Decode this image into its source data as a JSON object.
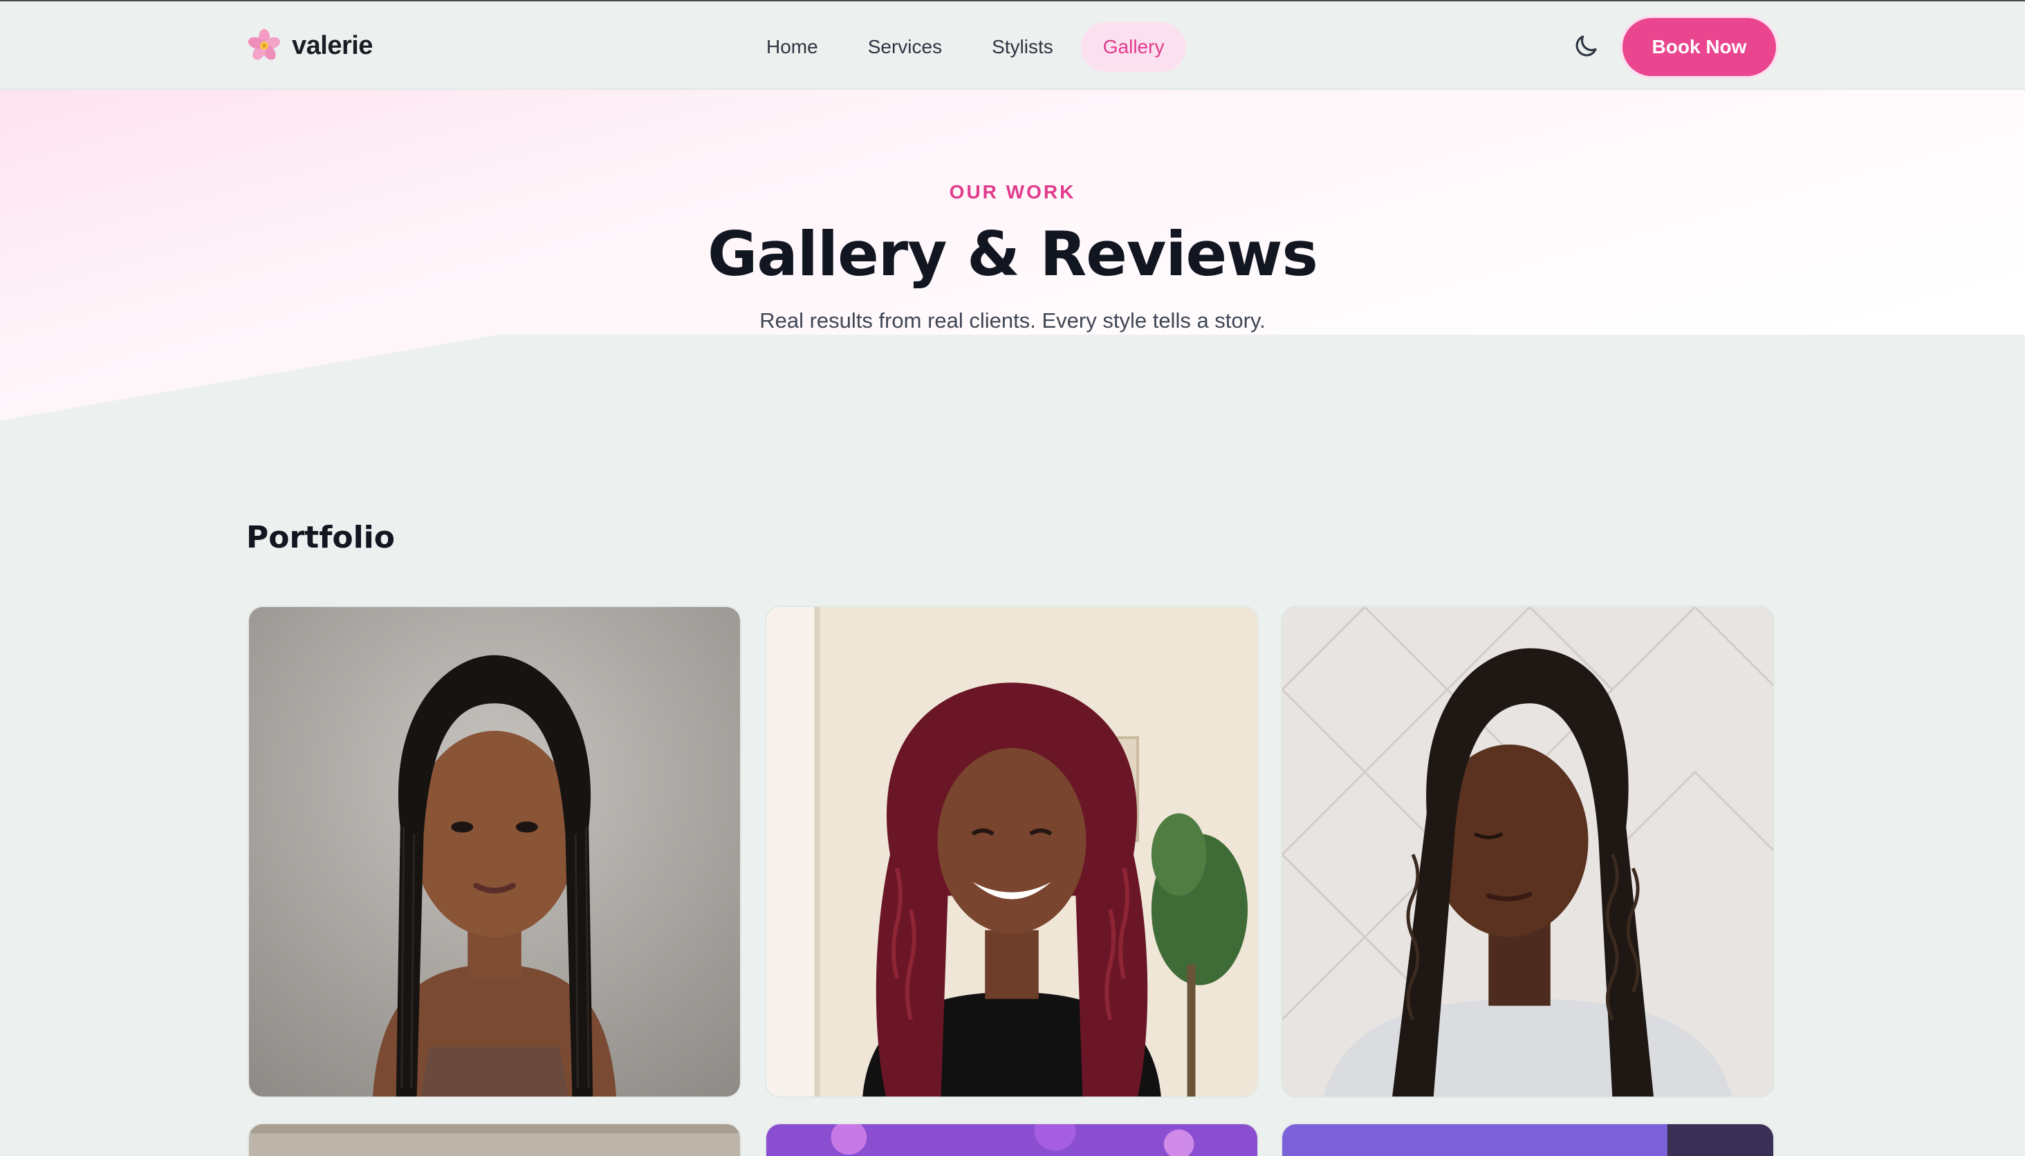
{
  "brand": {
    "name": "valerie",
    "logo_icon": "flower-icon"
  },
  "nav": {
    "items": [
      {
        "label": "Home",
        "active": false
      },
      {
        "label": "Services",
        "active": false
      },
      {
        "label": "Stylists",
        "active": false
      },
      {
        "label": "Gallery",
        "active": true
      }
    ],
    "theme_toggle_icon": "moon-icon",
    "cta_label": "Book Now"
  },
  "hero": {
    "eyebrow": "OUR WORK",
    "title": "Gallery & Reviews",
    "subtitle": "Real results from real clients. Every style tells a story."
  },
  "portfolio": {
    "heading": "Portfolio",
    "images": [
      {
        "name": "portfolio-image-knotless-braids"
      },
      {
        "name": "portfolio-image-burgundy-locs"
      },
      {
        "name": "portfolio-image-passion-twists"
      },
      {
        "name": "portfolio-image-4"
      },
      {
        "name": "portfolio-image-5"
      },
      {
        "name": "portfolio-image-6"
      }
    ]
  },
  "colors": {
    "accent": "#e9468f",
    "accent_soft": "#fbe1ef",
    "page_bg": "#ecf1ef",
    "heading": "#111620"
  }
}
